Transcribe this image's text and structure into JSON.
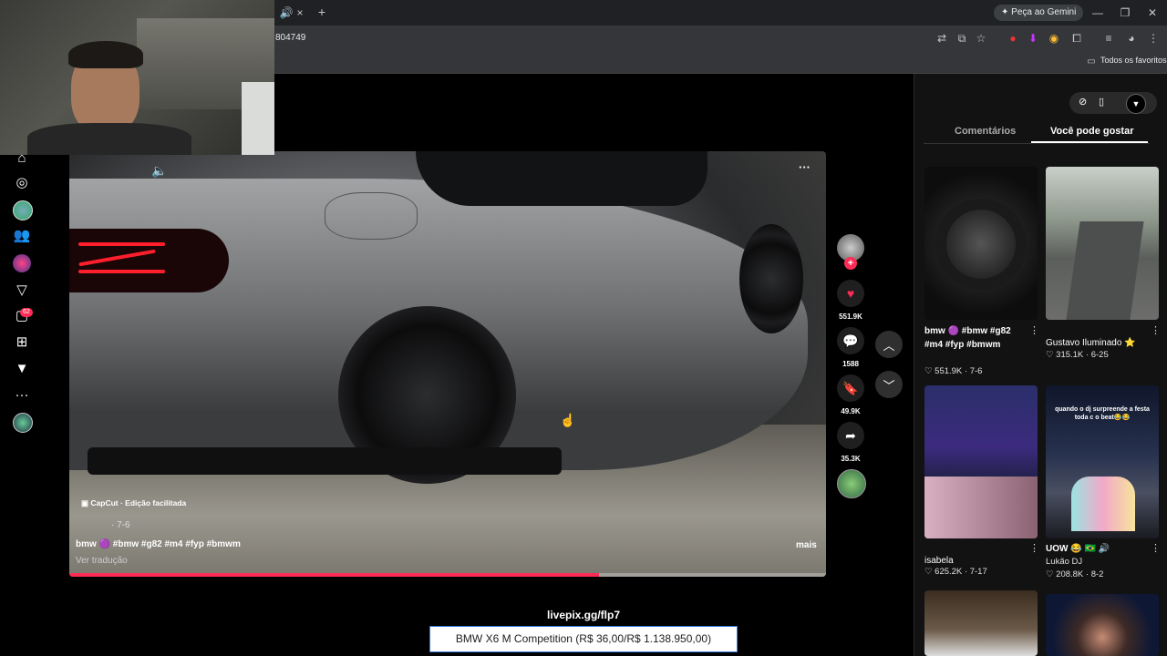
{
  "browser": {
    "url_fragment": "804749",
    "gemini_label": "Peça ao Gemini",
    "bookmarks_label": "Todos os favoritos",
    "new_tab_symbol": "+",
    "close_symbol": "×",
    "window_controls": [
      "—",
      "❐",
      "✕"
    ]
  },
  "left_rail": {
    "icons": [
      "home-icon",
      "explore-icon",
      "avatar",
      "following-icon",
      "avatar",
      "send-icon",
      "inbox-icon",
      "upload-icon",
      "logo-icon",
      "more-icon",
      "avatar"
    ],
    "inbox_badge": "62",
    "more_symbol": "···"
  },
  "video": {
    "capcut_label": "CapCut · Edição facilitada",
    "date": "· 7-6",
    "caption": "bmw 🟣 #bmw #g82 #m4 #fyp #bmwm",
    "translate_label": "Ver tradução",
    "more_label": "mais",
    "menu_symbol": "···",
    "progress_fraction": 0.7
  },
  "actions": {
    "likes": "551.9K",
    "comments": "1588",
    "saves": "49.9K",
    "shares": "35.3K"
  },
  "right_panel": {
    "tabs": [
      "Comentários",
      "Você pode gostar"
    ],
    "active_tab": 1,
    "cards": [
      {
        "title": "bmw 🟣 #bmw #g82 #m4 #fyp #bmwm",
        "likes": "551.9K",
        "date": "7-6"
      },
      {
        "title": "Gustavo Iluminado ⭐",
        "likes": "315.1K",
        "date": "6-25"
      },
      {
        "title": "isabela",
        "likes": "625.2K",
        "date": "7-17"
      },
      {
        "title": "UOW 😂 🇧🇷 🔊",
        "subtitle": "Lukão DJ",
        "likes": "208.8K",
        "date": "8-2"
      }
    ],
    "card4_overlay": "quando o dj surpreende a festa toda c o beat😂😂"
  },
  "overlay": {
    "livepix": "livepix.gg/flp7",
    "donation": "BMW X6 M Competition (R$ 36,00/R$ 1.138.950,00)"
  },
  "colors": {
    "accent": "#fe2c55",
    "panel_bg": "#121212"
  }
}
